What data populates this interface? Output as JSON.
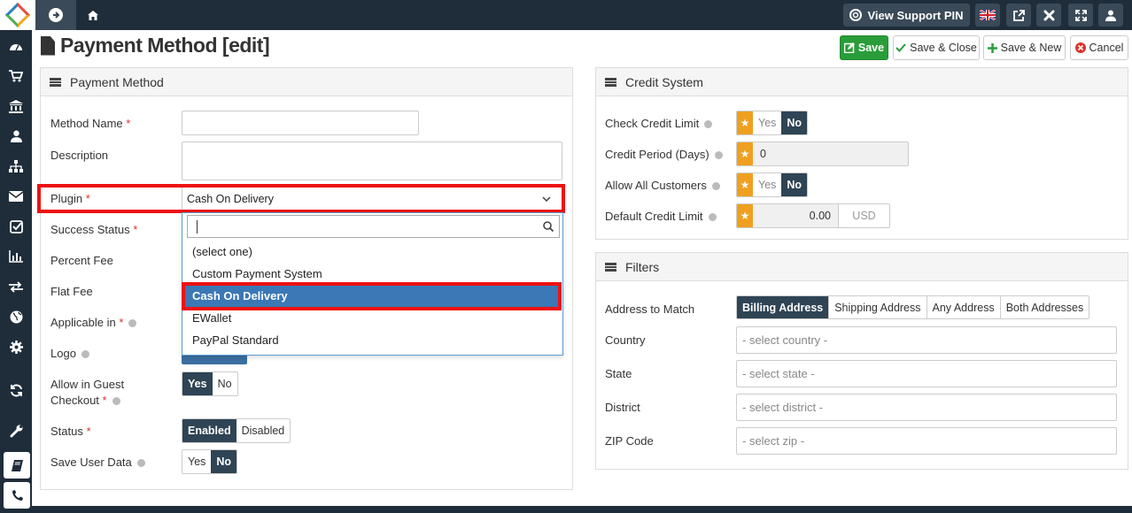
{
  "topbar": {
    "support_label": "View Support PIN"
  },
  "page": {
    "title": "Payment Method [edit]"
  },
  "actions": {
    "save": "Save",
    "save_close": "Save & Close",
    "save_new": "Save & New",
    "cancel": "Cancel"
  },
  "payment_panel": {
    "heading": "Payment Method",
    "method_name_label": "Method Name",
    "description_label": "Description",
    "plugin_label": "Plugin",
    "plugin_value": "Cash On Delivery",
    "success_status_label": "Success Status",
    "percent_fee_label": "Percent Fee",
    "flat_fee_label": "Flat Fee",
    "applicable_label": "Applicable in",
    "logo_label": "Logo",
    "guest_label_1": "Allow in Guest",
    "guest_label_2": "Checkout",
    "status_label": "Status",
    "save_user_label": "Save User Data",
    "yes": "Yes",
    "no": "No",
    "enabled": "Enabled",
    "disabled": "Disabled",
    "required_mark": "*"
  },
  "plugin_dropdown": {
    "options": [
      "(select one)",
      "Custom Payment System",
      "Cash On Delivery",
      "EWallet",
      "PayPal Standard"
    ]
  },
  "credit_panel": {
    "heading": "Credit System",
    "check_label": "Check Credit Limit",
    "period_label": "Credit Period (Days)",
    "period_value": "0",
    "allow_label": "Allow All Customers",
    "default_label": "Default Credit Limit",
    "default_value": "0.00",
    "currency": "USD",
    "yes": "Yes",
    "no": "No"
  },
  "filters_panel": {
    "heading": "Filters",
    "address_label": "Address to Match",
    "address_options": [
      "Billing Address",
      "Shipping Address",
      "Any Address",
      "Both Addresses"
    ],
    "country_label": "Country",
    "country_placeholder": "- select country -",
    "state_label": "State",
    "state_placeholder": "- select state -",
    "district_label": "District",
    "district_placeholder": "- select district -",
    "zip_label": "ZIP Code",
    "zip_placeholder": "- select zip -"
  }
}
